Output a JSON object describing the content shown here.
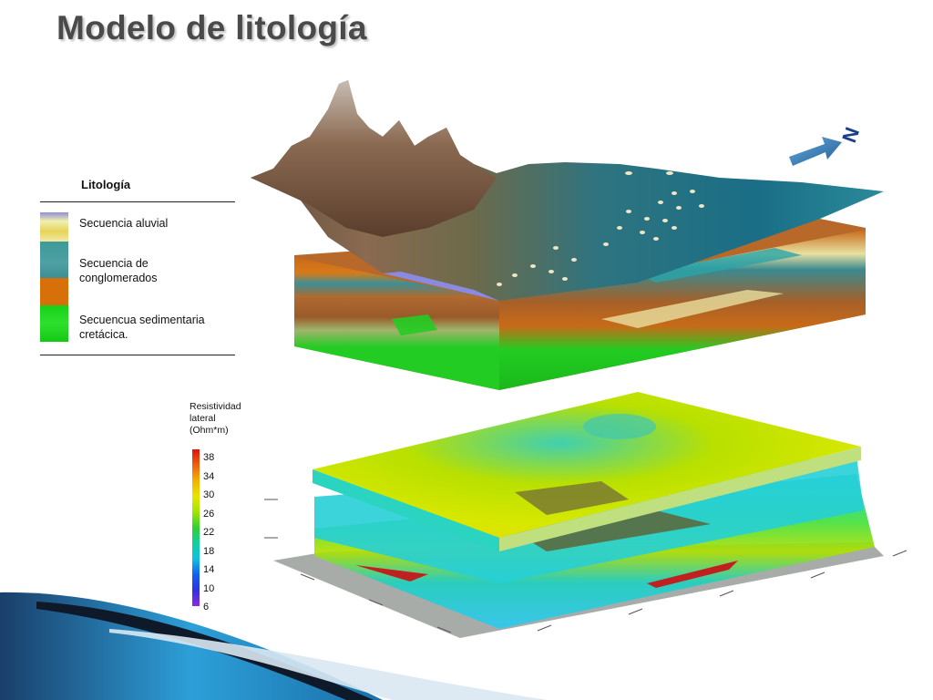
{
  "slide": {
    "title": "Modelo de litología"
  },
  "lithology_legend": {
    "title": "Litología",
    "items": [
      {
        "label_line1": "Secuencia aluvial",
        "label_line2": "",
        "color": "#e8d870"
      },
      {
        "label_line1": "Secuencia de",
        "label_line2": "conglomerados",
        "color": "#3f9a9a"
      },
      {
        "label_line1": "",
        "label_line2": "",
        "color": "#d77008"
      },
      {
        "label_line1": "Secuencua sedimentaria",
        "label_line2": "cretácica.",
        "color": "#1ed41e"
      }
    ]
  },
  "resistivity_legend": {
    "title_line1": "Resistividad",
    "title_line2": "lateral",
    "title_line3": "(Ohm*m)",
    "ticks": [
      "38",
      "34",
      "30",
      "26",
      "22",
      "18",
      "14",
      "10",
      "6"
    ]
  },
  "north_arrow": {
    "label": "N"
  },
  "colors": {
    "terrain_brown": "#8a6a50",
    "valley_teal": "#2f7f86",
    "block_orange": "#c86a18",
    "block_green": "#22cc22",
    "accent_blue": "#1a6fa8"
  }
}
